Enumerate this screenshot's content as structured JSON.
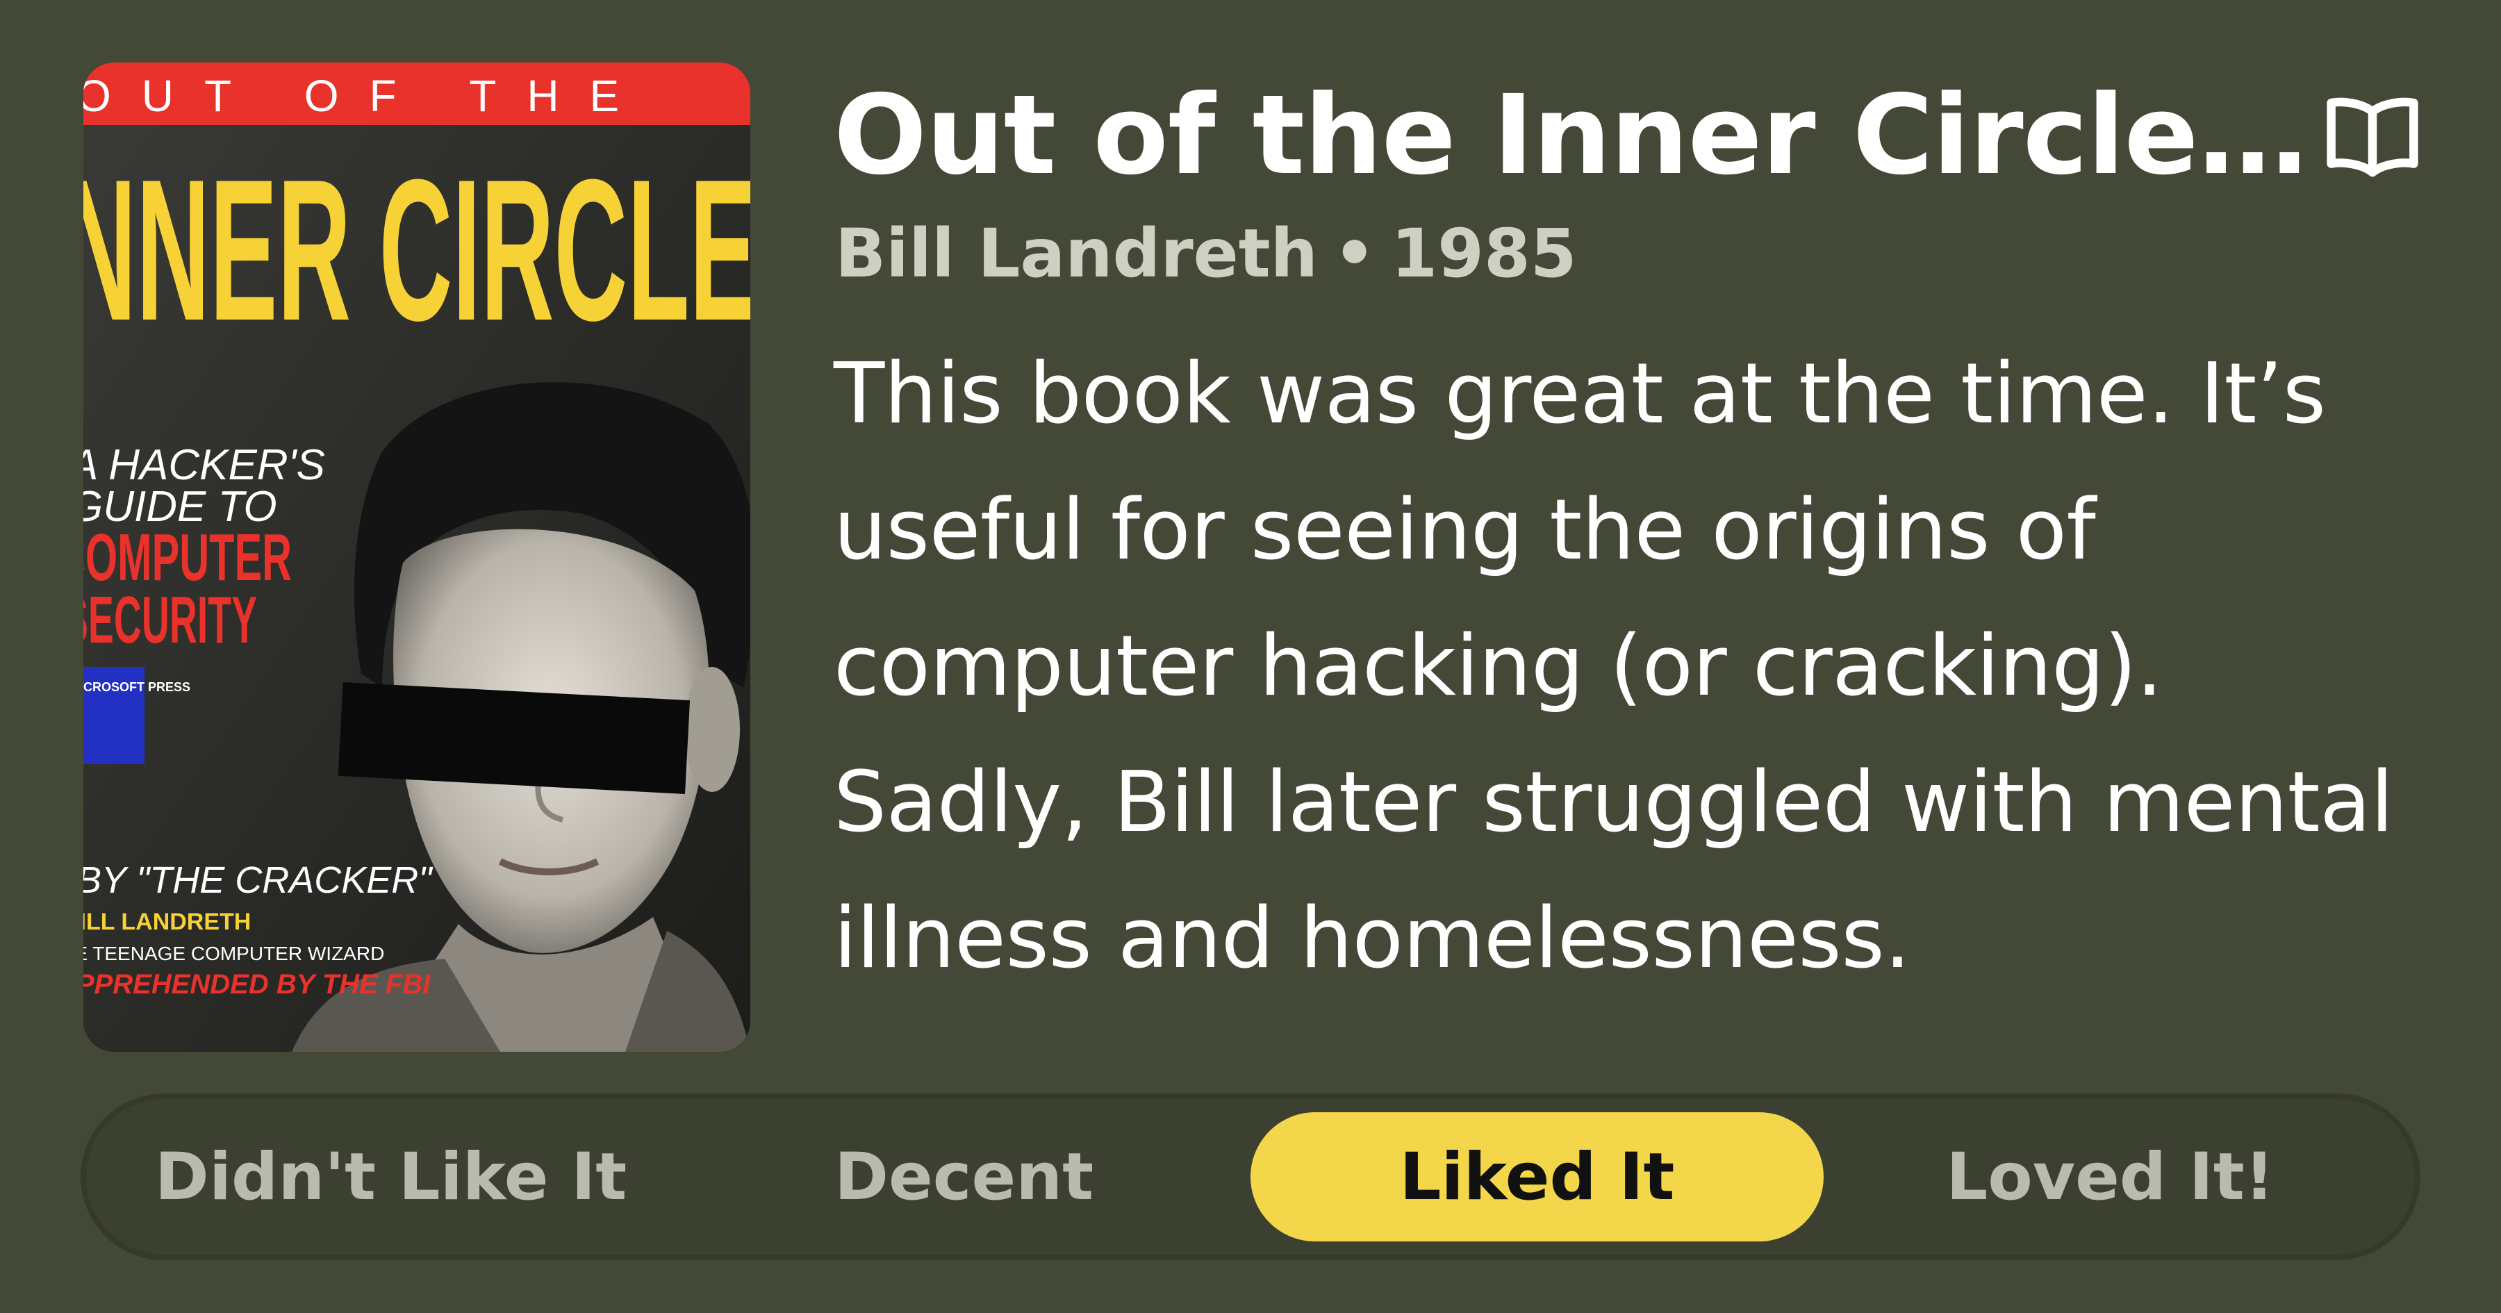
{
  "book": {
    "title": "Out of the Inner Circle: A Hacker's Guide to Computer Security",
    "author": "Bill Landreth",
    "separator": "•",
    "year": "1985",
    "review": "This book was great at the time. It’s useful for seeing the origins of computer hacking (or cracking). Sadly, Bill later struggled with mental illness and homelessness.",
    "action_icon": "open-book-icon"
  },
  "cover": {
    "top_banner": "OUT OF THE",
    "headline": "INNER CIRCLE",
    "tagline_1": "A HACKER'S",
    "tagline_2": "GUIDE TO",
    "tagline_3": "COMPUTER",
    "tagline_4": "SECURITY",
    "publisher": "MICROSOFT PRESS",
    "byline_1": "BY \"THE CRACKER\"",
    "byline_2": "BILL LANDRETH",
    "byline_3": "THE TEENAGE COMPUTER WIZARD",
    "byline_4": "APPREHENDED BY THE FBI"
  },
  "rating": {
    "options": [
      "Didn't Like It",
      "Decent",
      "Liked It",
      "Loved It!"
    ],
    "selected_index": 2
  },
  "colors": {
    "background": "#444836",
    "accent": "#f3d64a",
    "cover_banner": "#e8322b",
    "cover_headline": "#f7d236"
  }
}
